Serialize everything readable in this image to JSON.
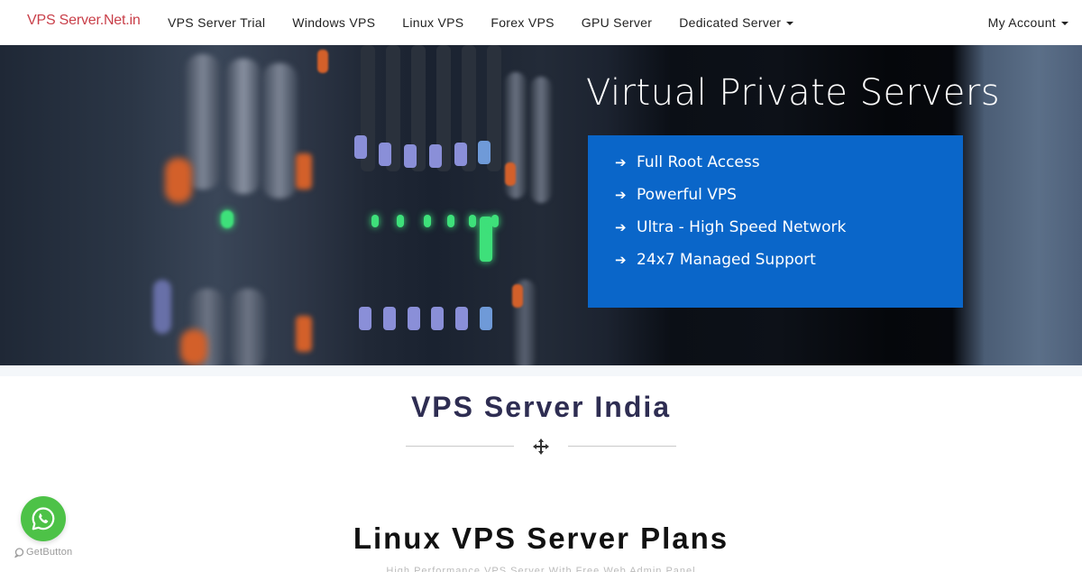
{
  "navbar": {
    "brand": "VPS Server.Net.in",
    "items": [
      {
        "label": "VPS Server Trial",
        "dropdown": false
      },
      {
        "label": "Windows VPS",
        "dropdown": false
      },
      {
        "label": "Linux VPS",
        "dropdown": false
      },
      {
        "label": "Forex VPS",
        "dropdown": false
      },
      {
        "label": "GPU Server",
        "dropdown": false
      },
      {
        "label": "Dedicated Server",
        "dropdown": true
      }
    ],
    "account_label": "My Account",
    "brand_color": "#c9404a"
  },
  "hero": {
    "title": "Virtual Private Servers",
    "features": [
      "Full Root Access",
      "Powerful VPS",
      "Ultra - High Speed Network",
      "24x7 Managed Support"
    ],
    "feature_icon": "arrow-right-icon",
    "box_color": "#0a66c9"
  },
  "section": {
    "title": "VPS Server India",
    "divider_icon": "move-arrows-icon"
  },
  "plans": {
    "title": "Linux VPS Server Plans",
    "subtitle": "High Performance VPS Server With Free Web Admin Panel"
  },
  "widget": {
    "icon": "whatsapp-icon",
    "brand_label": "GetButton",
    "color": "#4dc247"
  }
}
